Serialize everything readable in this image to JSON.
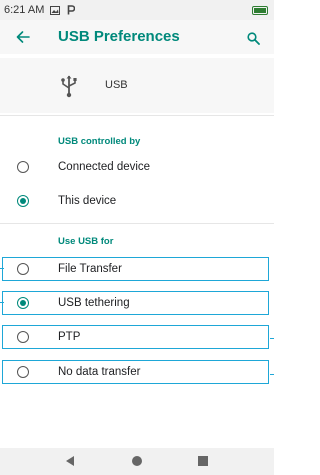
{
  "status_bar": {
    "time": "6:21 AM"
  },
  "header": {
    "title": "USB Preferences"
  },
  "usb_item": {
    "label": "USB"
  },
  "usb_controlled_by": {
    "title": "USB controlled by",
    "options": [
      {
        "label": "Connected device",
        "selected": false
      },
      {
        "label": "This device",
        "selected": true
      }
    ]
  },
  "use_usb_for": {
    "title": "Use USB for",
    "options": [
      {
        "label": "File Transfer",
        "selected": false
      },
      {
        "label": "USB tethering",
        "selected": true
      },
      {
        "label": "PTP",
        "selected": false
      },
      {
        "label": "No data transfer",
        "selected": false
      }
    ]
  },
  "colors": {
    "accent": "#00897b",
    "highlight": "#1ea7d7"
  }
}
